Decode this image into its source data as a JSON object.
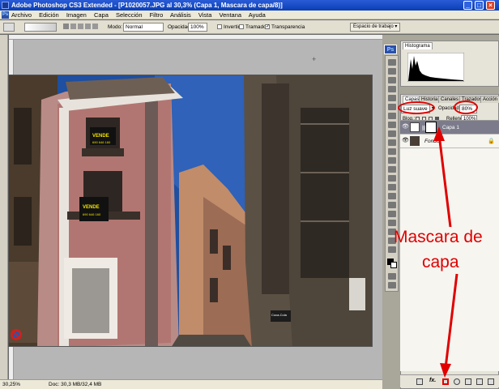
{
  "window": {
    "title": "Adobe Photoshop CS3 Extended - [P1020057.JPG al 30,3% (Capa 1, Mascara de capa/8)]",
    "minimize_glyph": "_",
    "maximize_glyph": "□",
    "close_glyph": "×"
  },
  "menubar": {
    "logo": "Ps",
    "items": [
      "Archivo",
      "Edición",
      "Imagen",
      "Capa",
      "Selección",
      "Filtro",
      "Análisis",
      "Vista",
      "Ventana",
      "Ayuda"
    ]
  },
  "options_bar": {
    "modo_label": "Modo:",
    "modo_value": "Normal",
    "opacidad_label": "Opacidad:",
    "opacidad_value": "100%",
    "invertir_label": "Invertir",
    "tramado_label": "Tramado",
    "transparencia_label": "Transparencia",
    "transparencia_checked": true,
    "workspace_button": "Espacio de trabajo ▾"
  },
  "status_bar": {
    "zoom": "30,25%",
    "doc_info": "Doc: 30,3 MB/32,4 MB"
  },
  "histogram_panel": {
    "tab": "Histograma",
    "logo": "Ps"
  },
  "layers_panel": {
    "tabs": [
      "Capas",
      "Historia",
      "Canales",
      "Trazados",
      "Acción"
    ],
    "blend_mode": "Luz suave",
    "opacity_label": "Opacidad:",
    "opacity_value": "80%",
    "lock_label": "Bloq.:",
    "fill_label": "Relleno:",
    "fill_value": "100%",
    "layers": [
      {
        "name": "Capa 1",
        "selected": true,
        "visible": true
      },
      {
        "name": "Fondo",
        "selected": false,
        "visible": true
      }
    ],
    "footer_icons": [
      "link-icon",
      "fx-icon",
      "add-mask-icon",
      "adjustment-icon",
      "group-icon",
      "new-layer-icon",
      "trash-icon"
    ]
  },
  "annotation": {
    "line1": "Mascara de",
    "line2": "capa",
    "color": "#e00000"
  },
  "photo_signs": {
    "vende1": "VENDE",
    "vende1_phone": "690 646 160",
    "vende2": "VENDE",
    "vende2_phone": "690 646 160",
    "cocacola": "Coca-Cola"
  }
}
